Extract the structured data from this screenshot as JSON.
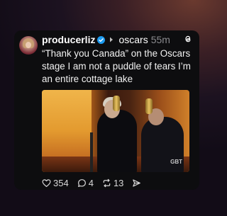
{
  "post": {
    "username": "producerliz",
    "community": "oscars",
    "time": "55m",
    "text": "“Thank you Canada” on the Oscars stage I am not a puddle of tears I’m an entire cottage lake",
    "media_watermark": "GBT",
    "stats": {
      "likes": "354",
      "replies": "4",
      "reposts": "13"
    }
  },
  "colors": {
    "card_bg": "#0d0d0f",
    "verified_blue": "#1d9bf0",
    "muted": "#8a8a8e"
  },
  "icons": [
    "verified-badge-icon",
    "chevron-right-icon",
    "threads-logo-icon",
    "heart-icon",
    "reply-icon",
    "repost-icon",
    "share-icon"
  ]
}
